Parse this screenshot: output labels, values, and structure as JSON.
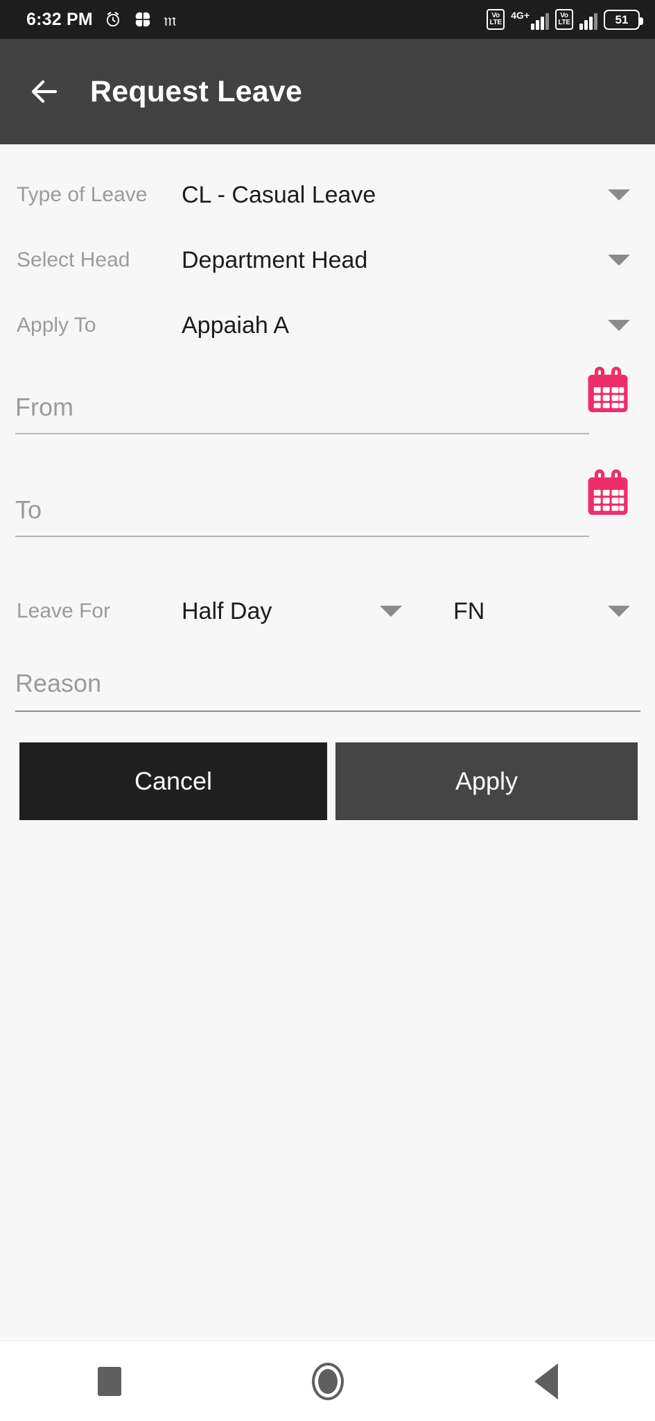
{
  "status_bar": {
    "time": "6:32 PM",
    "icons": [
      "alarm-clock-icon",
      "flower-app-icon",
      "m-app-icon"
    ],
    "network_label": "4G+",
    "volte_top": "Vo",
    "volte_bottom": "LTE",
    "battery_percent": "51"
  },
  "appbar": {
    "back_icon": "back-arrow-icon",
    "title": "Request Leave"
  },
  "form": {
    "type_of_leave": {
      "label": "Type of Leave",
      "value": "CL - Casual Leave"
    },
    "select_head": {
      "label": "Select Head",
      "value": "Department Head"
    },
    "apply_to": {
      "label": "Apply To",
      "value": "Appaiah A"
    },
    "from": {
      "placeholder": "From",
      "value": "",
      "icon": "calendar-icon"
    },
    "to": {
      "placeholder": "To",
      "value": "",
      "icon": "calendar-icon"
    },
    "leave_for": {
      "label": "Leave For",
      "duration": "Half Day",
      "session": "FN"
    },
    "reason": {
      "placeholder": "Reason",
      "value": ""
    }
  },
  "buttons": {
    "cancel": "Cancel",
    "apply": "Apply"
  },
  "nav_bar": {
    "recents": "square-recents-icon",
    "home": "circle-home-icon",
    "back": "triangle-back-icon"
  },
  "colors": {
    "accent_pink": "#ED2E6B",
    "appbar": "#424242",
    "statusbar": "#1d1d1d",
    "cancel_button": "#1f1f1f",
    "apply_button": "#454545",
    "page_background": "#f7f7f7",
    "label_text": "#9b9b9b",
    "value_text": "#1c1c1c"
  }
}
